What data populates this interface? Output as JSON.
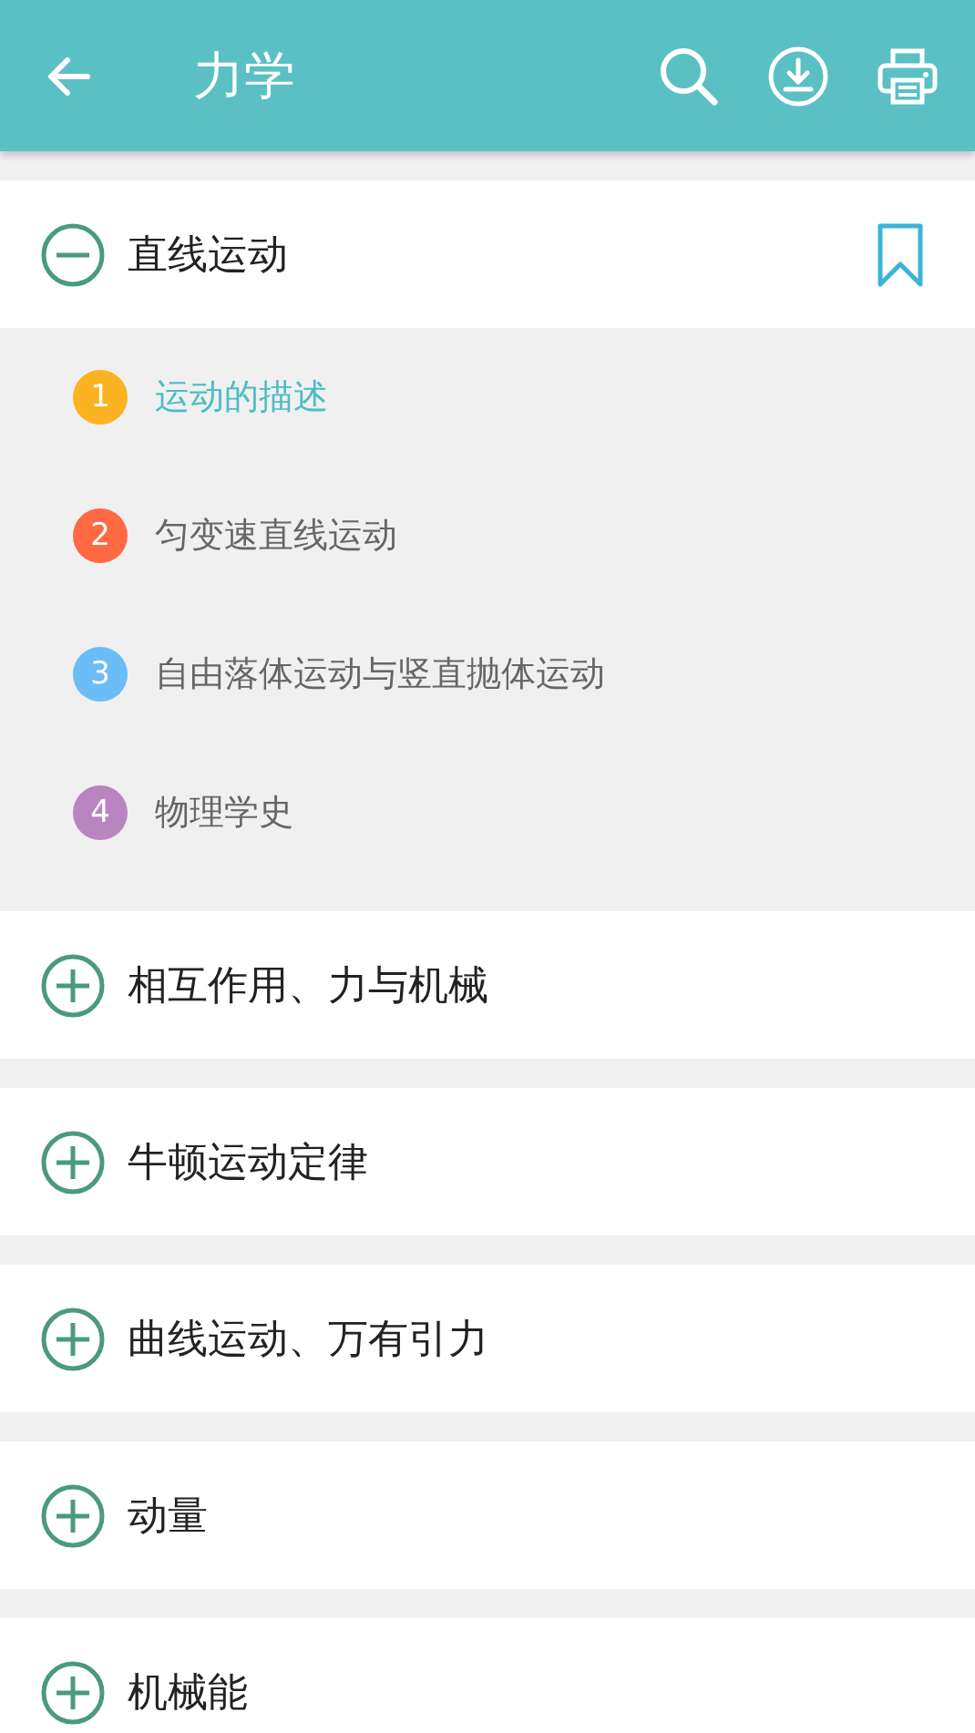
{
  "app_bar": {
    "title": "力学"
  },
  "sections": [
    {
      "title": "直线运动",
      "expanded": true,
      "bookmarked": true,
      "children": [
        {
          "number": "1",
          "title": "运动的描述",
          "color": "#fbb321",
          "selected": true
        },
        {
          "number": "2",
          "title": "匀变速直线运动",
          "color": "#ff6a45",
          "selected": false
        },
        {
          "number": "3",
          "title": "自由落体运动与竖直抛体运动",
          "color": "#6cbcf7",
          "selected": false
        },
        {
          "number": "4",
          "title": "物理学史",
          "color": "#b985c0",
          "selected": false
        }
      ]
    },
    {
      "title": "相互作用、力与机械",
      "expanded": false,
      "bookmarked": false
    },
    {
      "title": "牛顿运动定律",
      "expanded": false,
      "bookmarked": false
    },
    {
      "title": "曲线运动、万有引力",
      "expanded": false,
      "bookmarked": false
    },
    {
      "title": "动量",
      "expanded": false,
      "bookmarked": false
    },
    {
      "title": "机械能",
      "expanded": false,
      "bookmarked": false
    }
  ]
}
